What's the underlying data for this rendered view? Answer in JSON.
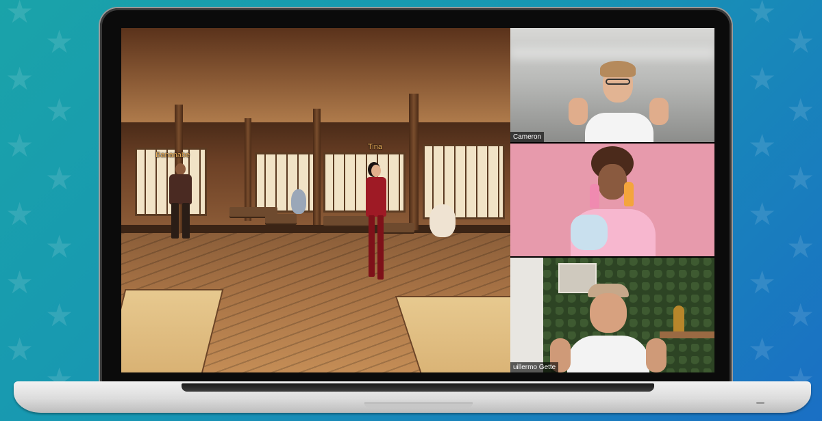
{
  "game": {
    "players": [
      {
        "name": "Bananabe"
      },
      {
        "name": "Tina"
      }
    ]
  },
  "video_call": {
    "participants": [
      {
        "name": "Cameron"
      },
      {
        "name": ""
      },
      {
        "name": "uillermo Gette"
      }
    ]
  },
  "colors": {
    "background_start": "#1aa3a9",
    "background_end": "#1a6fc4",
    "player_name": "#f0b25a",
    "name_tag_bg": "rgba(0,0,0,0.62)"
  }
}
